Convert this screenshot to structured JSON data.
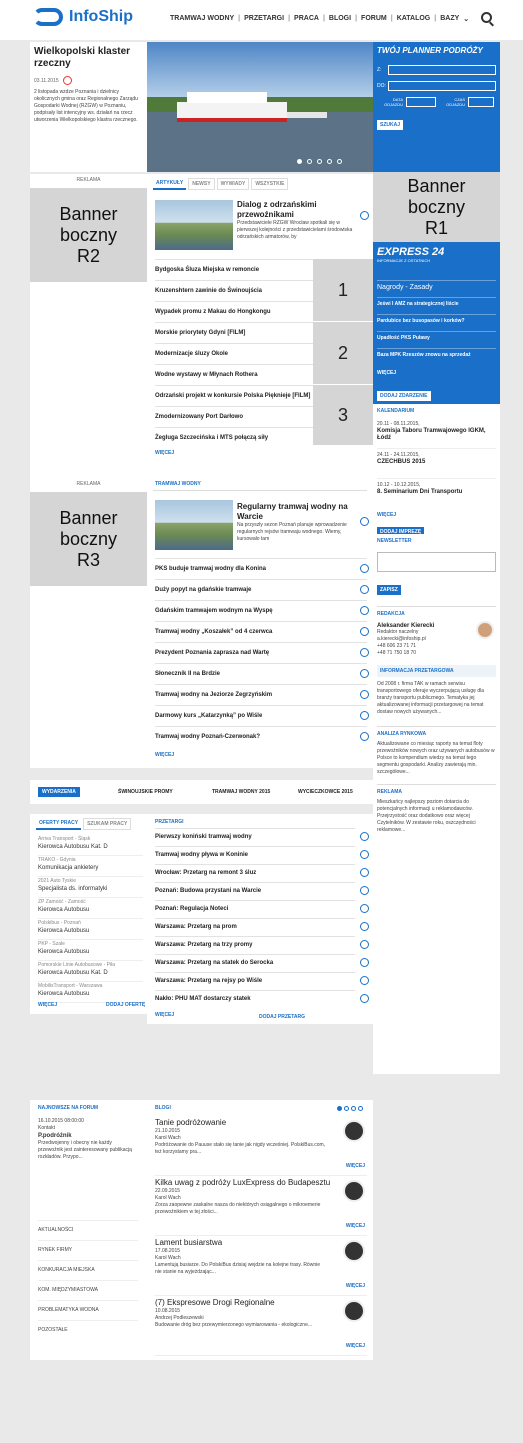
{
  "logo": "InfoShip",
  "nav": [
    "TRAMWAJ WODNY",
    "PRZETARGI",
    "PRACA",
    "BLOGI",
    "FORUM",
    "KATALOG",
    "BAZY"
  ],
  "hero": {
    "title": "Wielkopolski klaster rzeczny",
    "date": "03.11.2015",
    "text": "2 listopada wzdze Poznania i dzielnicy okolicznych gmina oraz Regionalnego Zarządu Gospodarki Wodnej (RZGW) w Poznaniu, podpisały list intencyjny ws. działań na rzecz utworzenia Wielkopolskiego klastra rzecznego."
  },
  "planner": {
    "title": "TWÓJ PLANNER PODRÓŻY",
    "z": "Z:",
    "do": "DO:",
    "data": "DATA ODJAZDU",
    "czas": "CZAS ODJAZDU",
    "btn": "SZUKAJ"
  },
  "banner_r1": "Banner boczny R1",
  "banner_r2": "Banner boczny R2",
  "banner_r3": "Banner boczny R3",
  "reklama": "REKLAMA",
  "articles": {
    "tabs": [
      "ARTYKUŁY",
      "NEWSY",
      "WYWIADY",
      "WSZYSTKIE"
    ],
    "lead_title": "Dialog z odrzańskimi przewoźnikami",
    "lead_text": "Przedstawiciele RZGW Wrocław spotkali się w pierwszej kolejności z przedstawicielami środowiska odrzańskich armatorów, by",
    "items": [
      "Bydgoska Śluza Miejska w remoncie",
      "Kruzenshtern zawinie do Świnoujścia",
      "Wypadek promu z Makau do Hongkongu",
      "Morskie priorytety Gdyni [FILM]",
      "Modernizacje śluzy Okole",
      "Wodne wystawy w Młynach Rothera",
      "Odrzański projekt w konkursie Polska Pięknieje [FILM]",
      "Zmodernizowany Port Darłowo",
      "Żegluga Szczecińska i MTS połączą siły"
    ],
    "nums": [
      "1",
      "2",
      "3"
    ],
    "more": "WIĘCEJ"
  },
  "express": {
    "title": "EXPRESS 24",
    "sub": "INFORMACJE Z OSTATNICH",
    "items": [
      "Nagrody - Zasady",
      "Jeświ I AMZ na strategicznej liście",
      "Pardubice bez busopasów i korków?",
      "Upadłość PKS Puławy",
      "Baza MPK Rzeszów znowu na sprzedaż"
    ],
    "more": "WIĘCEJ",
    "btn": "DODAJ ZDARZENIE"
  },
  "kalendarium": {
    "title": "KALENDARIUM",
    "events": [
      {
        "date": "20.11 - 08.11.2015,",
        "name": "Komisja Taboru Tramwajowego IGKM, Łódź"
      },
      {
        "date": "24.11 - 24.11.2015,",
        "name": "CZECHBUS 2015"
      },
      {
        "date": "10.12 - 10.12.2015,",
        "name": "8. Seminarium Dni Transportu"
      }
    ],
    "more": "WIĘCEJ",
    "btn": "DODAJ IMPREZĘ"
  },
  "tramwaj": {
    "title": "TRAMWAJ WODNY",
    "lead_title": "Regularny tramwaj wodny na Warcie",
    "lead_text": "Na przyszły sezon Poznań planuje wprowadzenie regularnych rejsów tramwaju wodnego. Wiemy, kursowało tam",
    "items": [
      "PKS buduje tramwaj wodny dla Konina",
      "Duży popyt na gdańskie tramwaje",
      "Gdańskim tramwajem wodnym na Wyspę",
      "Tramwaj wodny „Koszałek” od 4 czerwca",
      "Prezydent Poznania zaprasza nad Wartę",
      "Słoneczník II na Brdzie",
      "Tramwaj wodny na Jeziorze Zegrzyńskim",
      "Darmowy kurs „Katarzynką” po Wiśle",
      "Tramwaj wodny Poznań-Czerwonak?"
    ],
    "more": "WIĘCEJ"
  },
  "newsletter": {
    "title": "NEWSLETTER",
    "btn": "ZAPISZ"
  },
  "redakcja": {
    "title": "REDAKCJA",
    "name": "Aleksander Kierecki",
    "role": "Redaktor naczelny",
    "email": "a.kierecki@infoship.pl",
    "tel1": "+48 606 23 71 71",
    "tel2": "+48 71 750 18 70"
  },
  "info": {
    "title": "INFORMACJA PRZETARGOWA",
    "text": "Od 2008 r. firma TAK w ramach serwisu transportowego oferuje wyczerpującą usługę dla branży transportu publicznego. Tematyka jej aktualizowanej informacji przetargowej na temat dostaw nowych używanych..."
  },
  "analiza": {
    "title": "ANALIZA RYNKOWA",
    "text": "Aktualizowane co miesiąc raporty na temat floty przewoźników nowych oraz używanych autobusów w Polsce to kompendium wiedzy na temat tego segmentu gospodarki. Analizy zawierają min. szczegółowe..."
  },
  "reklama2": {
    "title": "REKLAMA",
    "text": "Mieszkańcy najlepszy poziom dotarcia do potencjalnych informacji u reklamodawców. Przejrzystość oraz dodatkowo oraz więcej Czytelników. W zestawie roku, oszczędności reklamowe..."
  },
  "wydarzenia": {
    "tabs": [
      "WYDARZENIA",
      "ŚWINOUJSKIE PROMY",
      "TRAMWAJ WODNY 2015",
      "WYCIECZKOWCE 2015"
    ]
  },
  "praca": {
    "tabs": [
      "OFERTY PRACY",
      "SZUKAM PRACY"
    ],
    "items": [
      {
        "co": "Arriva Transport - Śląsk",
        "job": "Kierowca Autobusu Kat. D"
      },
      {
        "co": "TRAKO - Gdynia",
        "job": "Komunikacja ankietery"
      },
      {
        "co": "2021 Auto Tyskie",
        "job": "Specjalista ds. informatyki"
      },
      {
        "co": "ZP Zamość - Zamość",
        "job": "Kierowca Autobusu"
      },
      {
        "co": "Polskibus - Poznań",
        "job": "Kierowca Autobusu"
      },
      {
        "co": "PKP - Szale",
        "job": "Kierowca Autobusu"
      },
      {
        "co": "Pomorskie Linie Autobusowe - Piła",
        "job": "Kierowca Autobusu Kat. D"
      },
      {
        "co": "MobilisTransport - Warszawa",
        "job": "Kierowca Autobusu"
      }
    ],
    "more": "WIĘCEJ",
    "add": "DODAJ OFERTĘ"
  },
  "przetargi": {
    "title": "PRZETARGI",
    "items": [
      "Pierwszy koniński tramwaj wodny",
      "Tramwaj wodny pływa w Koninie",
      "Wrocław: Przetarg na remont 3 śluz",
      "Poznań: Budowa przystani na Warcie",
      "Poznań: Regulacja Noteci",
      "Warszawa: Przetarg na prom",
      "Warszawa: Przetarg na trzy promy",
      "Warszawa: Przetarg na statek do Serocka",
      "Warszawa: Przetarg na rejsy po Wiśle",
      "Nakło: PHU MAT dostarczy statek"
    ],
    "more": "WIĘCEJ",
    "add": "DODAJ PRZETARG"
  },
  "forum": {
    "title": "NAJNOWSZE NA FORUM",
    "date": "16.10.2015 08:00:00",
    "cat": "Kontakt",
    "user": "P.podróżnik",
    "text": "Przedwojenny i obecny nie każdy przewoźnik jest zainteresowany publikacją rozkładów. Przypo...",
    "cats": [
      "AKTUALNOŚCI",
      "RYNEK FIRMY",
      "KONKURACJA MIEJSKA",
      "KOM. MIĘDZYMIASTOWA",
      "PROBLEMATYKA WODNA",
      "POZOSTAŁE"
    ]
  },
  "blogi": {
    "title": "BLOGI",
    "posts": [
      {
        "title": "Tanie podróżowanie",
        "date": "21.10.2015",
        "author": "Karol Wach",
        "text": "Podróżowanie do Pauuse stało się tanie jak nigdy wcześniej. PolskiBus.com, też korzystamy pra...",
        "more": "WIĘCEJ"
      },
      {
        "title": "Kilka uwag z podróży LuxExpress do Budapesztu",
        "date": "22.09.2015",
        "author": "Karol Wach",
        "text": "Zorza zaopewne zaskalne nasza do niektórych osiągalnego o mikroemerie przewoźnikiem w tej złości...",
        "more": "WIĘCEJ"
      },
      {
        "title": "Lament busiarstwa",
        "date": "17.08.2015",
        "author": "Karol Wach",
        "text": "Lamentują busiarze. Do PolskiBus dzisiaj wejdzie na kolejne trasy. Równie nie stanie na wyjeżdzając...",
        "more": "WIĘCEJ"
      },
      {
        "title": "(7) Ekspresowe Drogi Regionalne",
        "date": "10.08.2015",
        "author": "Andrzej Podleszewski",
        "text": "Budowanie dróg bez przewymierzonego wymiarowania - ekologiczne...",
        "more": "WIĘCEJ"
      }
    ]
  }
}
